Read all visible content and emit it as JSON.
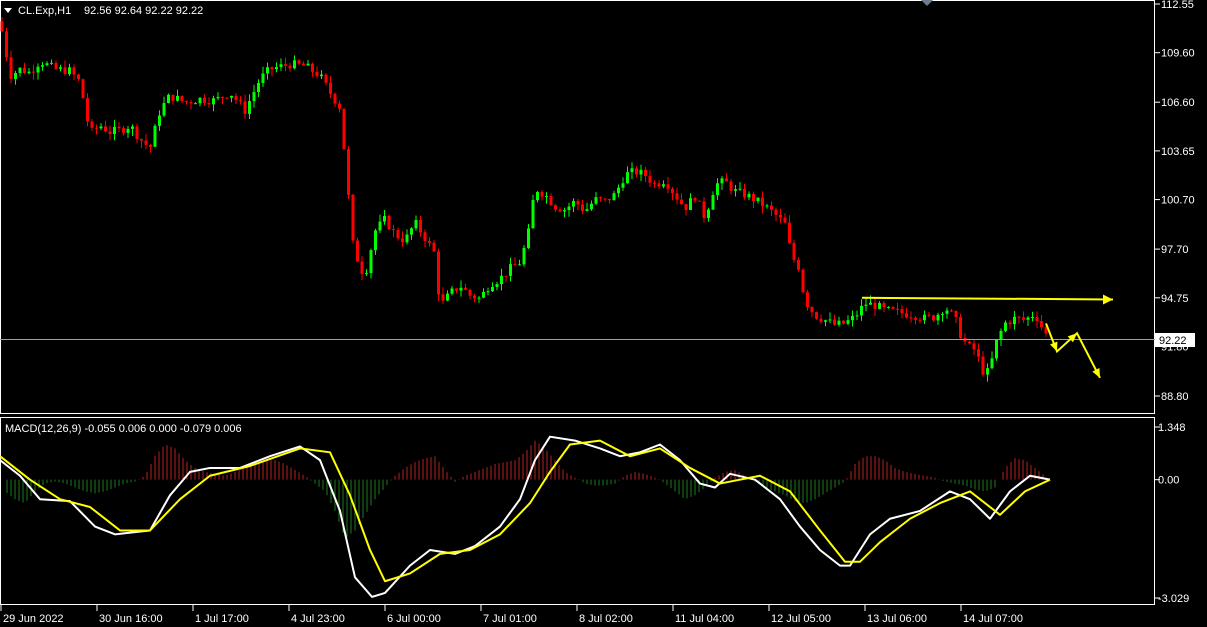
{
  "header": {
    "symbol": "CL.Exp,H1",
    "ohlc": "92.56 92.64 92.22 92.22"
  },
  "macd_header": {
    "label": "MACD(12,26,9) -0.055 0.006 0.000 -0.079 0.006"
  },
  "colors": {
    "background": "#000000",
    "bull_candle": "#00ff00",
    "bear_candle": "#ff0000",
    "grid_line": "#ffffff",
    "bid_line": "#9aa0a6",
    "macd_line": "#ffffff",
    "signal_line": "#ffff00",
    "hist_positive": "#b22222",
    "hist_negative": "#1f7a1f",
    "annotation": "#ffff00"
  },
  "chart_data": [
    {
      "type": "candlestick",
      "title": "CL.Exp,H1",
      "y_ticks": [
        "112.55",
        "109.60",
        "106.60",
        "103.65",
        "100.70",
        "97.70",
        "94.75",
        "91.80",
        "88.80"
      ],
      "ylim": [
        87.8,
        112.55
      ],
      "current_price": "92.22",
      "x_ticks": [
        "29 Jun 2022",
        "30 Jun 16:00",
        "1 Jul 17:00",
        "4 Jul 23:00",
        "6 Jul 00:00",
        "7 Jul 01:00",
        "8 Jul 02:00",
        "11 Jul 04:00",
        "12 Jul 05:00",
        "13 Jul 06:00",
        "14 Jul 07:00"
      ],
      "price_path": [
        [
          0,
          111.5
        ],
        [
          5,
          110
        ],
        [
          10,
          108.2
        ],
        [
          20,
          108.6
        ],
        [
          30,
          108.4
        ],
        [
          40,
          109.1
        ],
        [
          55,
          108.6
        ],
        [
          70,
          108.5
        ],
        [
          80,
          107.8
        ],
        [
          90,
          104.7
        ],
        [
          100,
          105.2
        ],
        [
          110,
          104.8
        ],
        [
          120,
          104.9
        ],
        [
          130,
          105.2
        ],
        [
          140,
          104.4
        ],
        [
          150,
          103.8
        ],
        [
          160,
          106.1
        ],
        [
          170,
          107.0
        ],
        [
          185,
          106.6
        ],
        [
          200,
          106.8
        ],
        [
          215,
          106.7
        ],
        [
          230,
          107.2
        ],
        [
          245,
          106.1
        ],
        [
          260,
          108.0
        ],
        [
          270,
          108.6
        ],
        [
          290,
          108.9
        ],
        [
          305,
          108.8
        ],
        [
          320,
          108.2
        ],
        [
          330,
          107.2
        ],
        [
          340,
          106.3
        ],
        [
          347,
          102
        ],
        [
          352,
          98.2
        ],
        [
          360,
          96.6
        ],
        [
          365,
          96.1
        ],
        [
          375,
          98.8
        ],
        [
          385,
          99.5
        ],
        [
          395,
          98.6
        ],
        [
          405,
          98.2
        ],
        [
          415,
          99.3
        ],
        [
          425,
          98.4
        ],
        [
          435,
          97.4
        ],
        [
          440,
          94.2
        ],
        [
          450,
          95.0
        ],
        [
          460,
          95.5
        ],
        [
          470,
          94.9
        ],
        [
          480,
          94.7
        ],
        [
          490,
          95.6
        ],
        [
          500,
          95.9
        ],
        [
          510,
          96.5
        ],
        [
          520,
          96.9
        ],
        [
          528,
          98.5
        ],
        [
          535,
          101.4
        ],
        [
          545,
          101.0
        ],
        [
          555,
          100.3
        ],
        [
          565,
          100.1
        ],
        [
          575,
          100.6
        ],
        [
          585,
          100.0
        ],
        [
          595,
          100.7
        ],
        [
          605,
          100.6
        ],
        [
          615,
          101.0
        ],
        [
          625,
          102.2
        ],
        [
          635,
          102.4
        ],
        [
          645,
          102.2
        ],
        [
          655,
          101.6
        ],
        [
          665,
          101.9
        ],
        [
          675,
          101.0
        ],
        [
          685,
          100.2
        ],
        [
          695,
          100.9
        ],
        [
          705,
          99.6
        ],
        [
          715,
          101.6
        ],
        [
          725,
          101.8
        ],
        [
          735,
          101.2
        ],
        [
          745,
          101.0
        ],
        [
          755,
          100.7
        ],
        [
          765,
          100.3
        ],
        [
          775,
          99.8
        ],
        [
          785,
          99.2
        ],
        [
          792,
          97.2
        ],
        [
          798,
          96.8
        ],
        [
          805,
          94.6
        ],
        [
          815,
          93.7
        ],
        [
          825,
          93.4
        ],
        [
          835,
          93.1
        ],
        [
          845,
          93.2
        ],
        [
          855,
          93.6
        ],
        [
          865,
          94.4
        ],
        [
          875,
          94.3
        ],
        [
          885,
          94.0
        ],
        [
          895,
          93.9
        ],
        [
          905,
          93.8
        ],
        [
          915,
          93.7
        ],
        [
          925,
          93.5
        ],
        [
          935,
          93.6
        ],
        [
          945,
          94.2
        ],
        [
          955,
          93.5
        ],
        [
          962,
          92.3
        ],
        [
          968,
          91.8
        ],
        [
          975,
          91.6
        ],
        [
          985,
          90.0
        ],
        [
          990,
          90.5
        ],
        [
          997,
          92.2
        ],
        [
          1005,
          93.2
        ],
        [
          1015,
          93.5
        ],
        [
          1025,
          93.4
        ],
        [
          1035,
          93.8
        ],
        [
          1045,
          92.6
        ],
        [
          1050,
          92.22
        ]
      ],
      "annotations": {
        "resistance_line": [
          [
            862,
            94.75
          ],
          [
            1113,
            94.65
          ]
        ],
        "projection_path": [
          [
            1046,
            93.2
          ],
          [
            1057,
            91.5
          ],
          [
            1077,
            92.6
          ],
          [
            1100,
            89.9
          ]
        ]
      }
    },
    {
      "type": "line",
      "title": "MACD(12,26,9)",
      "y_ticks": [
        "1.348",
        "0.00",
        "-3.029"
      ],
      "ylim": [
        -3.029,
        1.348
      ],
      "series": [
        {
          "name": "MACD",
          "values": [
            [
              0,
              0.5
            ],
            [
              20,
              0.1
            ],
            [
              40,
              -0.5
            ],
            [
              70,
              -0.55
            ],
            [
              95,
              -1.2
            ],
            [
              115,
              -1.4
            ],
            [
              150,
              -1.3
            ],
            [
              170,
              -0.4
            ],
            [
              190,
              0.2
            ],
            [
              210,
              0.3
            ],
            [
              240,
              0.3
            ],
            [
              270,
              0.6
            ],
            [
              300,
              0.85
            ],
            [
              320,
              0.5
            ],
            [
              340,
              -0.8
            ],
            [
              355,
              -2.5
            ],
            [
              372,
              -3.0
            ],
            [
              385,
              -2.9
            ],
            [
              410,
              -2.2
            ],
            [
              430,
              -1.8
            ],
            [
              455,
              -1.9
            ],
            [
              475,
              -1.7
            ],
            [
              500,
              -1.2
            ],
            [
              520,
              -0.5
            ],
            [
              535,
              0.5
            ],
            [
              550,
              1.1
            ],
            [
              575,
              1.0
            ],
            [
              600,
              0.8
            ],
            [
              620,
              0.6
            ],
            [
              640,
              0.7
            ],
            [
              660,
              0.9
            ],
            [
              680,
              0.5
            ],
            [
              700,
              -0.1
            ],
            [
              715,
              -0.2
            ],
            [
              730,
              0.15
            ],
            [
              755,
              0.0
            ],
            [
              780,
              -0.5
            ],
            [
              800,
              -1.2
            ],
            [
              820,
              -1.8
            ],
            [
              840,
              -2.2
            ],
            [
              850,
              -2.2
            ],
            [
              870,
              -1.4
            ],
            [
              890,
              -1.0
            ],
            [
              920,
              -0.8
            ],
            [
              950,
              -0.3
            ],
            [
              970,
              -0.5
            ],
            [
              990,
              -1.0
            ],
            [
              1010,
              -0.3
            ],
            [
              1030,
              0.1
            ],
            [
              1050,
              0.0
            ]
          ]
        },
        {
          "name": "Signal",
          "values": [
            [
              0,
              0.6
            ],
            [
              30,
              0.0
            ],
            [
              60,
              -0.5
            ],
            [
              90,
              -0.7
            ],
            [
              120,
              -1.3
            ],
            [
              150,
              -1.3
            ],
            [
              180,
              -0.5
            ],
            [
              210,
              0.1
            ],
            [
              250,
              0.35
            ],
            [
              300,
              0.8
            ],
            [
              330,
              0.7
            ],
            [
              350,
              -0.4
            ],
            [
              370,
              -1.8
            ],
            [
              385,
              -2.6
            ],
            [
              410,
              -2.4
            ],
            [
              440,
              -1.9
            ],
            [
              470,
              -1.8
            ],
            [
              500,
              -1.4
            ],
            [
              530,
              -0.6
            ],
            [
              550,
              0.2
            ],
            [
              570,
              0.9
            ],
            [
              600,
              1.0
            ],
            [
              630,
              0.6
            ],
            [
              660,
              0.8
            ],
            [
              690,
              0.3
            ],
            [
              720,
              -0.1
            ],
            [
              760,
              0.1
            ],
            [
              790,
              -0.3
            ],
            [
              820,
              -1.3
            ],
            [
              845,
              -2.1
            ],
            [
              860,
              -2.1
            ],
            [
              880,
              -1.6
            ],
            [
              910,
              -1.0
            ],
            [
              940,
              -0.6
            ],
            [
              970,
              -0.3
            ],
            [
              1000,
              -0.9
            ],
            [
              1025,
              -0.3
            ],
            [
              1050,
              0.0
            ]
          ]
        }
      ],
      "histogram": [
        [
          5,
          -0.3
        ],
        [
          15,
          -0.5
        ],
        [
          25,
          -0.6
        ],
        [
          35,
          -0.3
        ],
        [
          45,
          -0.1
        ],
        [
          55,
          -0.05
        ],
        [
          65,
          -0.1
        ],
        [
          75,
          -0.2
        ],
        [
          85,
          -0.3
        ],
        [
          95,
          -0.35
        ],
        [
          105,
          -0.3
        ],
        [
          115,
          -0.2
        ],
        [
          125,
          -0.1
        ],
        [
          135,
          -0.05
        ],
        [
          145,
          0.1
        ],
        [
          155,
          0.6
        ],
        [
          165,
          0.9
        ],
        [
          175,
          0.8
        ],
        [
          185,
          0.5
        ],
        [
          195,
          0.3
        ],
        [
          205,
          0.2
        ],
        [
          215,
          0.15
        ],
        [
          225,
          0.1
        ],
        [
          235,
          0.2
        ],
        [
          245,
          0.3
        ],
        [
          255,
          0.4
        ],
        [
          265,
          0.5
        ],
        [
          275,
          0.5
        ],
        [
          285,
          0.4
        ],
        [
          295,
          0.25
        ],
        [
          305,
          0.1
        ],
        [
          315,
          -0.1
        ],
        [
          325,
          -0.3
        ],
        [
          335,
          -0.8
        ],
        [
          345,
          -1.5
        ],
        [
          355,
          -1.3
        ],
        [
          365,
          -0.9
        ],
        [
          375,
          -0.5
        ],
        [
          385,
          -0.2
        ],
        [
          395,
          0.1
        ],
        [
          405,
          0.3
        ],
        [
          415,
          0.45
        ],
        [
          425,
          0.55
        ],
        [
          435,
          0.6
        ],
        [
          445,
          0.25
        ],
        [
          455,
          -0.05
        ],
        [
          465,
          0.1
        ],
        [
          475,
          0.2
        ],
        [
          485,
          0.3
        ],
        [
          495,
          0.4
        ],
        [
          505,
          0.45
        ],
        [
          515,
          0.5
        ],
        [
          525,
          0.7
        ],
        [
          535,
          1.0
        ],
        [
          545,
          0.8
        ],
        [
          555,
          0.5
        ],
        [
          565,
          0.2
        ],
        [
          575,
          0.05
        ],
        [
          585,
          -0.1
        ],
        [
          595,
          -0.15
        ],
        [
          605,
          -0.15
        ],
        [
          615,
          -0.1
        ],
        [
          625,
          0.1
        ],
        [
          635,
          0.2
        ],
        [
          645,
          0.15
        ],
        [
          655,
          0.05
        ],
        [
          665,
          -0.1
        ],
        [
          675,
          -0.3
        ],
        [
          685,
          -0.5
        ],
        [
          695,
          -0.4
        ],
        [
          705,
          -0.2
        ],
        [
          715,
          0.05
        ],
        [
          725,
          0.2
        ],
        [
          735,
          0.25
        ],
        [
          745,
          0.1
        ],
        [
          755,
          -0.05
        ],
        [
          765,
          -0.2
        ],
        [
          775,
          -0.3
        ],
        [
          785,
          -0.4
        ],
        [
          795,
          -0.55
        ],
        [
          805,
          -0.6
        ],
        [
          815,
          -0.5
        ],
        [
          825,
          -0.35
        ],
        [
          835,
          -0.2
        ],
        [
          845,
          -0.05
        ],
        [
          855,
          0.4
        ],
        [
          865,
          0.6
        ],
        [
          875,
          0.6
        ],
        [
          885,
          0.5
        ],
        [
          895,
          0.3
        ],
        [
          905,
          0.2
        ],
        [
          915,
          0.15
        ],
        [
          925,
          0.1
        ],
        [
          935,
          0.05
        ],
        [
          945,
          -0.05
        ],
        [
          955,
          -0.1
        ],
        [
          965,
          -0.15
        ],
        [
          975,
          -0.25
        ],
        [
          985,
          -0.3
        ],
        [
          995,
          -0.2
        ],
        [
          1005,
          0.3
        ],
        [
          1015,
          0.55
        ],
        [
          1025,
          0.5
        ],
        [
          1035,
          0.3
        ],
        [
          1045,
          0.1
        ]
      ]
    }
  ]
}
